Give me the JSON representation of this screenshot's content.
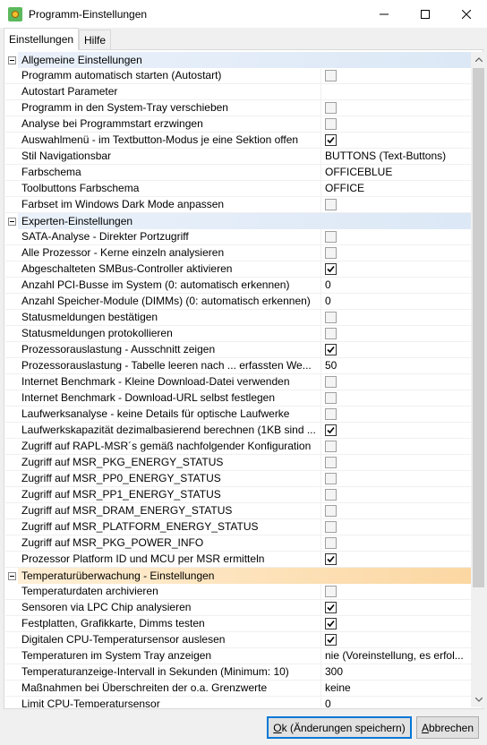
{
  "window": {
    "title": "Programm-Einstellungen"
  },
  "tabs": [
    {
      "label": "Einstellungen",
      "active": true
    },
    {
      "label": "Hilfe",
      "active": false
    }
  ],
  "sections": [
    {
      "title": "Allgemeine Einstellungen",
      "style": "blue",
      "rows": [
        {
          "name": "Programm automatisch starten (Autostart)",
          "type": "checkbox",
          "checked": false
        },
        {
          "name": "Autostart Parameter",
          "type": "text",
          "value": ""
        },
        {
          "name": "Programm in den System-Tray verschieben",
          "type": "checkbox",
          "checked": false
        },
        {
          "name": "Analyse bei Programmstart erzwingen",
          "type": "checkbox",
          "checked": false
        },
        {
          "name": "Auswahlmenü - im Textbutton-Modus je eine Sektion offen",
          "type": "checkbox",
          "checked": true
        },
        {
          "name": "Stil Navigationsbar",
          "type": "text",
          "value": "BUTTONS (Text-Buttons)"
        },
        {
          "name": "Farbschema",
          "type": "text",
          "value": "OFFICEBLUE"
        },
        {
          "name": "Toolbuttons Farbschema",
          "type": "text",
          "value": "OFFICE"
        },
        {
          "name": "Farbset im Windows Dark Mode anpassen",
          "type": "checkbox",
          "checked": false
        }
      ]
    },
    {
      "title": "Experten-Einstellungen",
      "style": "blue",
      "rows": [
        {
          "name": "SATA-Analyse - Direkter Portzugriff",
          "type": "checkbox",
          "checked": false
        },
        {
          "name": "Alle Prozessor - Kerne einzeln analysieren",
          "type": "checkbox",
          "checked": false
        },
        {
          "name": "Abgeschalteten SMBus-Controller aktivieren",
          "type": "checkbox",
          "checked": true
        },
        {
          "name": "Anzahl PCI-Busse im System (0: automatisch erkennen)",
          "type": "text",
          "value": "0"
        },
        {
          "name": "Anzahl Speicher-Module (DIMMs) (0: automatisch erkennen)",
          "type": "text",
          "value": "0"
        },
        {
          "name": "Statusmeldungen bestätigen",
          "type": "checkbox",
          "checked": false
        },
        {
          "name": "Statusmeldungen protokollieren",
          "type": "checkbox",
          "checked": false
        },
        {
          "name": "Prozessorauslastung - Ausschnitt zeigen",
          "type": "checkbox",
          "checked": true
        },
        {
          "name": "Prozessorauslastung - Tabelle leeren nach ... erfassten We...",
          "type": "text",
          "value": "50"
        },
        {
          "name": "Internet Benchmark - Kleine Download-Datei verwenden",
          "type": "checkbox",
          "checked": false
        },
        {
          "name": "Internet Benchmark - Download-URL selbst festlegen",
          "type": "checkbox",
          "checked": false
        },
        {
          "name": "Laufwerksanalyse - keine Details für optische Laufwerke",
          "type": "checkbox",
          "checked": false
        },
        {
          "name": "Laufwerkskapazität dezimalbasierend berechnen (1KB sind ...",
          "type": "checkbox",
          "checked": true
        },
        {
          "name": "Zugriff auf RAPL-MSR´s gemäß nachfolgender Konfiguration",
          "type": "checkbox",
          "checked": false
        },
        {
          "name": "Zugriff auf MSR_PKG_ENERGY_STATUS",
          "type": "checkbox",
          "checked": false
        },
        {
          "name": "Zugriff auf MSR_PP0_ENERGY_STATUS",
          "type": "checkbox",
          "checked": false
        },
        {
          "name": "Zugriff auf MSR_PP1_ENERGY_STATUS",
          "type": "checkbox",
          "checked": false
        },
        {
          "name": "Zugriff auf MSR_DRAM_ENERGY_STATUS",
          "type": "checkbox",
          "checked": false
        },
        {
          "name": "Zugriff auf MSR_PLATFORM_ENERGY_STATUS",
          "type": "checkbox",
          "checked": false
        },
        {
          "name": "Zugriff auf MSR_PKG_POWER_INFO",
          "type": "checkbox",
          "checked": false
        },
        {
          "name": "Prozessor Platform ID und MCU per MSR ermitteln",
          "type": "checkbox",
          "checked": true
        }
      ]
    },
    {
      "title": "Temperaturüberwachung - Einstellungen",
      "style": "orange",
      "rows": [
        {
          "name": "Temperaturdaten archivieren",
          "type": "checkbox",
          "checked": false
        },
        {
          "name": "Sensoren via LPC Chip analysieren",
          "type": "checkbox",
          "checked": true
        },
        {
          "name": "Festplatten, Grafikkarte, Dimms testen",
          "type": "checkbox",
          "checked": true
        },
        {
          "name": "Digitalen CPU-Temperatursensor auslesen",
          "type": "checkbox",
          "checked": true
        },
        {
          "name": "Temperaturen im System Tray anzeigen",
          "type": "text",
          "value": "nie (Voreinstellung, es erfol..."
        },
        {
          "name": "Temperaturanzeige-Intervall  in Sekunden (Minimum: 10)",
          "type": "text",
          "value": "300"
        },
        {
          "name": "Maßnahmen bei Überschreiten der o.a. Grenzwerte",
          "type": "text",
          "value": "keine"
        },
        {
          "name": "Limit CPU-Temperatursensor",
          "type": "text",
          "value": "0"
        }
      ]
    }
  ],
  "buttons": {
    "ok_prefix": "O",
    "ok_rest": "k (Änderungen speichern)",
    "cancel_prefix": "A",
    "cancel_rest": "bbrechen"
  }
}
